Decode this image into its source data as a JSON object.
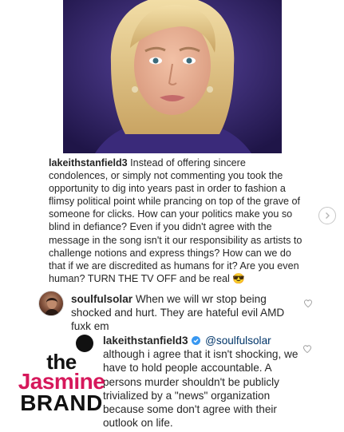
{
  "post": {
    "image_icon": "woman-portrait-photo",
    "caption": {
      "username": "lakeithstanfield3",
      "text": " Instead of offering sincere condolences, or simply not commenting you took the opportunity to dig into years past in order to fashion a flimsy political point while prancing on top of the grave of someone for clicks. How can your politics make you so blind in defiance? Even if you didn't agree with the message in the song isn't it our responsibility as artists to challenge notions and express things? How can we do that if we are discredited as humans for it? Are you even human? TURN THE TV OFF and be real ",
      "emoji": "😎"
    }
  },
  "comments": [
    {
      "username": "soulfulsolar",
      "text": " When we will wr stop being shocked and hurt. They are hateful evil AMD fuxk em"
    },
    {
      "username": "lakeithstanfield3",
      "mention": "@soulfulsolar",
      "text": "although i agree that it isn't shocking, we have to hold people accountable. A persons murder shouldn't be publicly trivialized by a \"news\" organization because some don't agree with their outlook on life."
    }
  ],
  "watermark": {
    "line1": "the",
    "line2": "Jasmine",
    "line3": "BRAND"
  },
  "colors": {
    "text": "#262626",
    "brand_pink": "#d6185b",
    "verified_blue": "#3897f0"
  }
}
